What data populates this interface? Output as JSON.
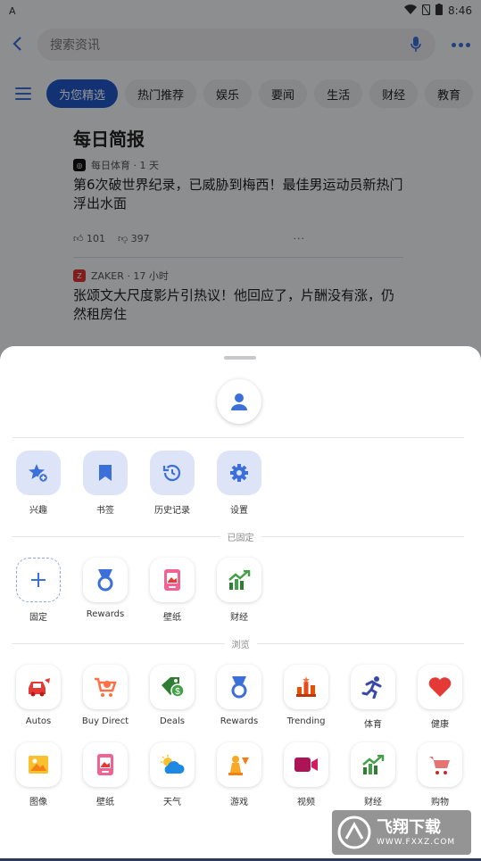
{
  "status": {
    "time": "8:46",
    "left_indicator": "A"
  },
  "search": {
    "placeholder": "搜索资讯"
  },
  "tabs": [
    {
      "label": "为您精选",
      "active": true
    },
    {
      "label": "热门推荐"
    },
    {
      "label": "娱乐"
    },
    {
      "label": "要闻"
    },
    {
      "label": "生活"
    },
    {
      "label": "财经"
    },
    {
      "label": "教育"
    }
  ],
  "feed": {
    "section_title": "每日简报",
    "articles": [
      {
        "source": "每日体育 · 1 天",
        "headline": "第6次破世界纪录，已威胁到梅西！最佳男运动员新热门浮出水面",
        "likes": "101",
        "dislikes": "397",
        "more": "···"
      },
      {
        "source": "ZAKER · 17 小时",
        "headline": "张颂文大尺度影片引热议！他回应了，片酬没有涨，仍然租房住"
      }
    ]
  },
  "sheet": {
    "quick": [
      {
        "label": "兴趣",
        "icon": "star-add-icon"
      },
      {
        "label": "书签",
        "icon": "bookmark-icon"
      },
      {
        "label": "历史记录",
        "icon": "history-icon"
      },
      {
        "label": "设置",
        "icon": "gear-icon"
      }
    ],
    "pinned_label": "已固定",
    "pinned": [
      {
        "label": "固定",
        "icon": "plus-icon"
      },
      {
        "label": "Rewards",
        "icon": "medal-icon"
      },
      {
        "label": "壁纸",
        "icon": "wallpaper-icon"
      },
      {
        "label": "财经",
        "icon": "finance-icon"
      }
    ],
    "browse_label": "浏览",
    "browse_row1": [
      {
        "label": "Autos",
        "icon": "car-icon"
      },
      {
        "label": "Buy Direct",
        "icon": "cart-icon"
      },
      {
        "label": "Deals",
        "icon": "deals-icon"
      },
      {
        "label": "Rewards",
        "icon": "medal-icon"
      },
      {
        "label": "Trending",
        "icon": "trending-icon"
      },
      {
        "label": "体育",
        "icon": "runner-icon"
      },
      {
        "label": "健康",
        "icon": "heart-icon"
      }
    ],
    "browse_row2": [
      {
        "label": "图像",
        "icon": "image-icon"
      },
      {
        "label": "壁纸",
        "icon": "wallpaper-icon"
      },
      {
        "label": "天气",
        "icon": "weather-icon"
      },
      {
        "label": "游戏",
        "icon": "games-icon"
      },
      {
        "label": "视频",
        "icon": "video-icon"
      },
      {
        "label": "财经",
        "icon": "finance-icon"
      },
      {
        "label": "购物",
        "icon": "shopping-cart-icon"
      }
    ]
  },
  "watermark": {
    "title": "飞翔下载",
    "url": "WWW.FXXZ.COM"
  },
  "colors": {
    "accent": "#2257c9",
    "icon_blue": "#3b6fd9"
  }
}
